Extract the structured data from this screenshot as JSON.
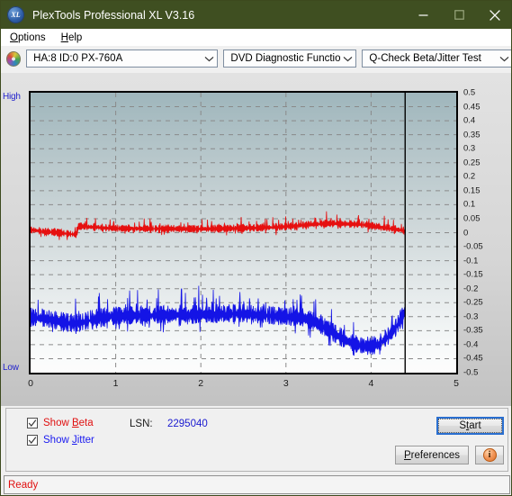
{
  "window": {
    "title": "PlexTools Professional XL V3.16",
    "logo_text": "XL",
    "minimize_icon": "minimize-icon",
    "maximize_icon": "maximize-icon",
    "close_icon": "close-icon",
    "titlebar_color": "#3f4f21"
  },
  "menubar": {
    "items": [
      {
        "label": "Options",
        "mnemonic": "O",
        "rest": "ptions"
      },
      {
        "label": "Help",
        "mnemonic": "H",
        "rest": "elp"
      }
    ]
  },
  "toolbar": {
    "drive_icon": "disc-icon",
    "drive_select": "HA:8 ID:0  PX-760A",
    "function_select": "DVD Diagnostic Functions",
    "test_select": "Q-Check Beta/Jitter Test",
    "arrow_icon": "chevron-down-icon"
  },
  "controls": {
    "show_beta_label_pre": "Show ",
    "show_beta_mnemonic": "B",
    "show_beta_label_post": "eta",
    "show_beta_checked": true,
    "show_beta_color": "#e01010",
    "show_jitter_label_pre": "Show ",
    "show_jitter_mnemonic": "J",
    "show_jitter_label_post": "itter",
    "show_jitter_checked": true,
    "show_jitter_color": "#1a1af0",
    "lsn_label": "LSN:",
    "lsn_value": "2295040",
    "start_pre": "S",
    "start_mnemonic": "t",
    "start_post": "art",
    "start_label": "Start",
    "preferences_pre": "",
    "preferences_mnemonic": "P",
    "preferences_post": "references",
    "info_icon": "info-icon",
    "info_glyph": "i"
  },
  "statusbar": {
    "text": "Ready",
    "color": "#e01010"
  },
  "chart_data": {
    "type": "line",
    "title": "Q-Check Beta/Jitter Test",
    "xlabel": "",
    "ylabel": "",
    "xlim": [
      0,
      5
    ],
    "ylim": [
      -0.5,
      0.5
    ],
    "grid": true,
    "grid_color": "#8a8a8a",
    "y_axis_top_label": "High",
    "y_axis_bottom_label": "Low",
    "y_axis_label_color": "#2222cc",
    "xticks": [
      0,
      1,
      2,
      3,
      4,
      5
    ],
    "yticks": [
      0.5,
      0.45,
      0.4,
      0.35,
      0.3,
      0.25,
      0.2,
      0.15,
      0.1,
      0.05,
      0,
      -0.05,
      -0.1,
      -0.15,
      -0.2,
      -0.25,
      -0.3,
      -0.35,
      -0.4,
      -0.45,
      -0.5
    ],
    "ytick_labels": [
      "0.5",
      "0.45",
      "0.4",
      "0.35",
      "0.3",
      "0.25",
      "0.2",
      "0.15",
      "0.1",
      "0.05",
      "0",
      "-0.05",
      "-0.1",
      "-0.15",
      "-0.2",
      "-0.25",
      "-0.3",
      "-0.35",
      "-0.4",
      "-0.45",
      "-0.5"
    ],
    "data_end_marker_x": 4.4,
    "plot_bg_gradient_top": "#9fb6bc",
    "plot_bg_gradient_bottom": "#fdfdfd",
    "series": [
      {
        "name": "Beta",
        "color": "#e61010",
        "noise_amplitude": 0.012,
        "x": [
          0.0,
          0.1,
          0.2,
          0.3,
          0.4,
          0.5,
          0.54,
          0.56,
          0.6,
          0.7,
          0.8,
          0.9,
          1.0,
          1.2,
          1.4,
          1.6,
          1.8,
          2.0,
          2.2,
          2.4,
          2.6,
          2.8,
          3.0,
          3.2,
          3.4,
          3.5,
          3.6,
          3.7,
          3.8,
          3.9,
          4.0,
          4.1,
          4.2,
          4.3,
          4.4
        ],
        "y": [
          0.01,
          0.006,
          0.003,
          0.0,
          -0.003,
          -0.006,
          -0.008,
          0.022,
          0.022,
          0.02,
          0.018,
          0.016,
          0.015,
          0.014,
          0.014,
          0.014,
          0.013,
          0.013,
          0.014,
          0.015,
          0.016,
          0.018,
          0.021,
          0.026,
          0.031,
          0.032,
          0.032,
          0.031,
          0.03,
          0.028,
          0.025,
          0.021,
          0.016,
          0.011,
          0.006
        ]
      },
      {
        "name": "Jitter",
        "color": "#1414e6",
        "noise_amplitude": 0.03,
        "x": [
          0.0,
          0.1,
          0.2,
          0.3,
          0.4,
          0.5,
          0.6,
          0.7,
          0.8,
          0.9,
          1.0,
          1.2,
          1.4,
          1.6,
          1.8,
          2.0,
          2.2,
          2.4,
          2.5,
          2.6,
          2.7,
          2.8,
          2.9,
          3.0,
          3.1,
          3.2,
          3.3,
          3.4,
          3.5,
          3.6,
          3.7,
          3.8,
          3.9,
          4.0,
          4.05,
          4.1,
          4.2,
          4.3,
          4.35,
          4.4
        ],
        "y": [
          -0.305,
          -0.306,
          -0.31,
          -0.316,
          -0.322,
          -0.326,
          -0.322,
          -0.314,
          -0.308,
          -0.303,
          -0.3,
          -0.297,
          -0.296,
          -0.295,
          -0.294,
          -0.294,
          -0.292,
          -0.29,
          -0.291,
          -0.294,
          -0.296,
          -0.297,
          -0.3,
          -0.302,
          -0.303,
          -0.305,
          -0.316,
          -0.33,
          -0.348,
          -0.368,
          -0.385,
          -0.398,
          -0.406,
          -0.407,
          -0.404,
          -0.396,
          -0.372,
          -0.336,
          -0.31,
          -0.282
        ]
      }
    ]
  }
}
